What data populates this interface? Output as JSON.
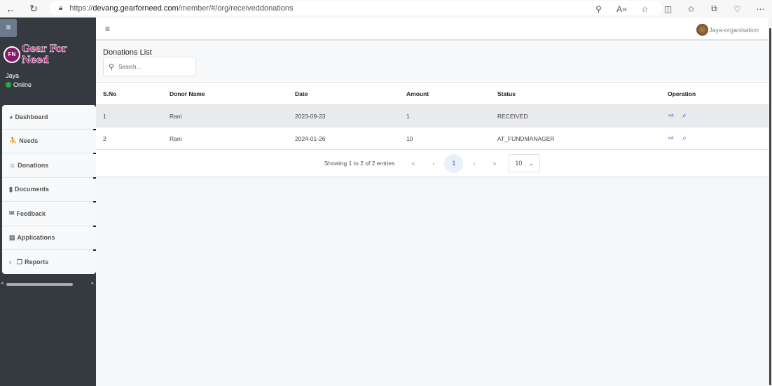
{
  "browser": {
    "url_prefix": "https://",
    "url_domain": "devang.gearforneed.com",
    "url_path": "/member/#/org/receiveddonations",
    "icons": [
      "back-icon",
      "refresh-icon",
      "lock-icon",
      "zoom-icon",
      "read-aloud-icon",
      "favorite-icon",
      "split-screen-icon",
      "favorites-icon",
      "collections-icon",
      "browser-essentials-icon",
      "more-icon"
    ]
  },
  "sidebar": {
    "logo_text": "Gear For Need",
    "logo_mark": "FN",
    "user": "Jaya",
    "status": "Online",
    "status_color": "#28a745",
    "items": [
      {
        "label": "Dashboard",
        "icon": "◕"
      },
      {
        "label": "Needs",
        "icon": "⛹"
      },
      {
        "label": "Donations",
        "icon": "☺"
      },
      {
        "label": "Documents",
        "icon": "▮"
      },
      {
        "label": "Feedback",
        "icon": "✉"
      },
      {
        "label": "Applications",
        "icon": "▤"
      },
      {
        "label": "Reports",
        "icon": "❐"
      }
    ]
  },
  "topnav": {
    "profile": "Jaya-organisation"
  },
  "page": {
    "title": "Donations List",
    "search_placeholder": "Search..."
  },
  "table": {
    "headers": [
      "S.No",
      "Donor Name",
      "Date",
      "Amount",
      "Status",
      "Operation"
    ],
    "rows": [
      [
        "1",
        "Rani",
        "2023-09-23",
        "1",
        "RECEIVED"
      ],
      [
        "2",
        "Rani",
        "2024-01-26",
        "10",
        "AT_FUNDMANAGER"
      ]
    ]
  },
  "pager": {
    "info": "Showing 1 to 2 of 2 entries",
    "first": "«",
    "prev": "‹",
    "page": "1",
    "next": "›",
    "last": "»",
    "page_size": "10"
  },
  "colors": {
    "sidebar": "#343a40",
    "link": "#4a4adc"
  }
}
